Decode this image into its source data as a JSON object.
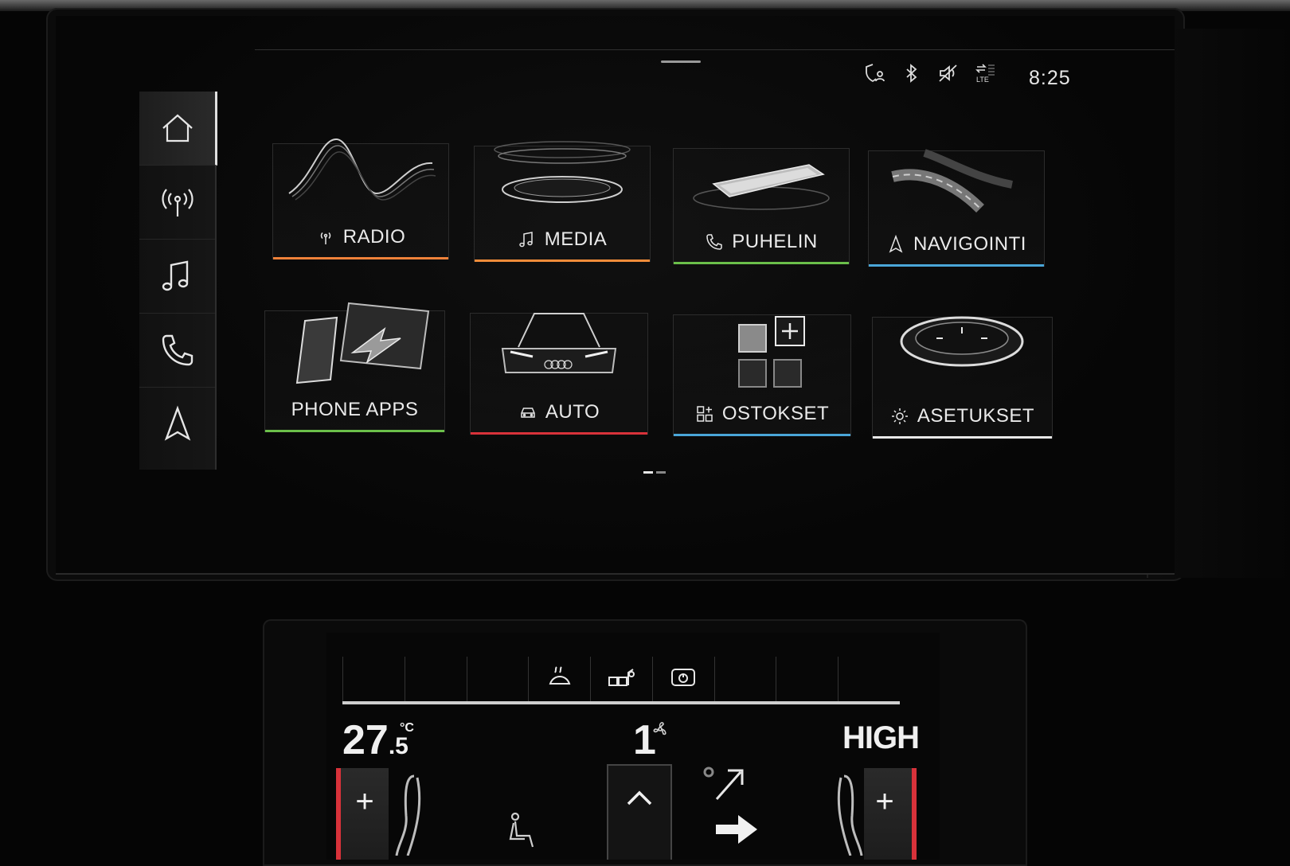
{
  "status_bar": {
    "time": "8:25",
    "icons": [
      "privacy-shield-icon",
      "bluetooth-icon",
      "mute-icon",
      "lte-signal-icon"
    ],
    "lte_label": "LTE"
  },
  "sidebar": {
    "items": [
      {
        "id": "home",
        "icon": "home-icon",
        "active": true
      },
      {
        "id": "radio",
        "icon": "radio-antenna-icon"
      },
      {
        "id": "media",
        "icon": "music-note-icon"
      },
      {
        "id": "phone",
        "icon": "phone-icon"
      },
      {
        "id": "navigation",
        "icon": "navigation-arrow-icon"
      }
    ]
  },
  "tiles": [
    {
      "id": "radio",
      "label": "RADIO",
      "icon": "radio-antenna-icon",
      "accent": "#f0823a"
    },
    {
      "id": "media",
      "label": "MEDIA",
      "icon": "music-note-icon",
      "accent": "#f08c3a"
    },
    {
      "id": "puhelin",
      "label": "PUHELIN",
      "icon": "phone-icon",
      "accent": "#6bbf4a"
    },
    {
      "id": "navigointi",
      "label": "NAVIGOINTI",
      "icon": "navigation-arrow-icon",
      "accent": "#4aa6d8"
    },
    {
      "id": "phone-apps",
      "label": "PHONE APPS",
      "icon": "",
      "accent": "#6bbf4a"
    },
    {
      "id": "auto",
      "label": "AUTO",
      "icon": "car-icon",
      "accent": "#d8323a"
    },
    {
      "id": "ostokset",
      "label": "OSTOKSET",
      "icon": "grid-plus-icon",
      "accent": "#4aa6d8"
    },
    {
      "id": "asetukset",
      "label": "ASETUKSET",
      "icon": "gear-icon",
      "accent": "#e8e8e8"
    }
  ],
  "pagination": {
    "pages": 2,
    "current": 1
  },
  "climate": {
    "tabs": [
      "",
      "",
      "",
      "defrost-icon",
      "recirculation-icon",
      "seat-power-icon",
      "",
      "",
      ""
    ],
    "left_temp_whole": "27",
    "left_temp_decimal": ".5",
    "left_temp_unit": "°C",
    "fan_level": "1",
    "right_temp": "HIGH",
    "plus_left": "+",
    "plus_right": "+"
  }
}
